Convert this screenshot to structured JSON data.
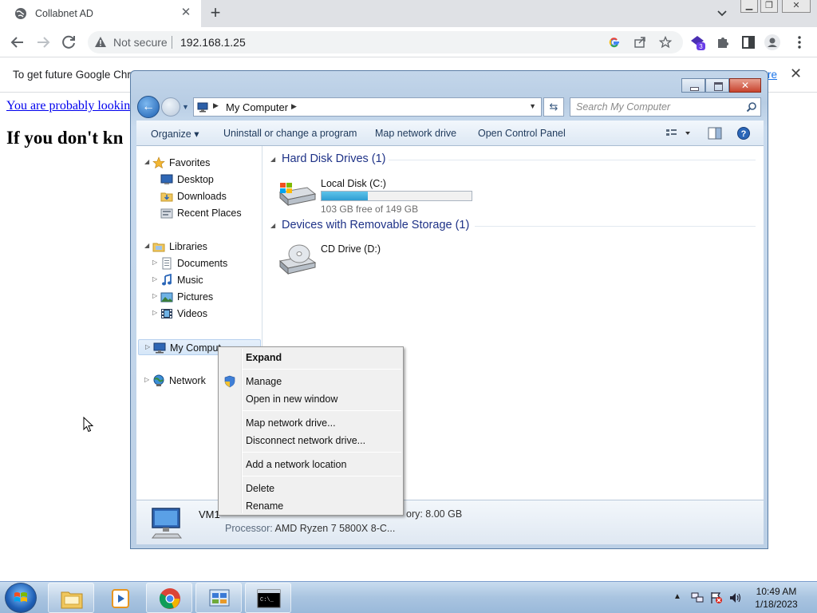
{
  "browser": {
    "tab_title": "Collabnet AD",
    "new_tab": "+",
    "security_label": "Not secure",
    "url": "192.168.1.25",
    "extension_badge": "3",
    "infobar_message": "To get future Google Chro",
    "infobar_link": "re"
  },
  "page": {
    "link_text": "You are probably lookin",
    "heading_text": "If you don't kn"
  },
  "explorer": {
    "breadcrumb": "My Computer",
    "search_placeholder": "Search My Computer",
    "commands": {
      "organize": "Organize",
      "uninstall": "Uninstall or change a program",
      "map_drive": "Map network drive",
      "control_panel": "Open Control Panel"
    },
    "nav": {
      "favorites": "Favorites",
      "desktop": "Desktop",
      "downloads": "Downloads",
      "recent": "Recent Places",
      "libraries": "Libraries",
      "documents": "Documents",
      "music": "Music",
      "pictures": "Pictures",
      "videos": "Videos",
      "my_computer": "My Comput",
      "network": "Network"
    },
    "groups": {
      "hdd": "Hard Disk Drives (1)",
      "removable": "Devices with Removable Storage (1)"
    },
    "drives": {
      "c_name": "Local Disk (C:)",
      "c_free": "103 GB free of 149 GB",
      "c_used_fraction": 0.31,
      "d_name": "CD Drive (D:)"
    },
    "details": {
      "name": "VM1",
      "memory": "ory: 8.00 GB",
      "processor_key": "Processor:",
      "processor_value": "AMD Ryzen 7 5800X 8-C..."
    }
  },
  "context_menu": {
    "expand": "Expand",
    "manage": "Manage",
    "open_new_window": "Open in new window",
    "map_drive": "Map network drive...",
    "disconnect_drive": "Disconnect network drive...",
    "add_location": "Add a network location",
    "delete": "Delete",
    "rename": "Rename"
  },
  "taskbar": {
    "time": "10:49 AM",
    "date": "1/18/2023"
  },
  "colors": {
    "accent": "#1a73e8",
    "explorer_frame": "#c3d6ea",
    "group_title": "#1e3287",
    "progress_fill": "#2f9ed2"
  },
  "icons": [
    "globe-icon",
    "close-icon",
    "chevron-down-icon",
    "back-arrow-icon",
    "forward-arrow-icon",
    "reload-icon",
    "warning-icon",
    "google-icon",
    "share-icon",
    "star-icon",
    "extension-icon",
    "puzzle-icon",
    "sidepanel-icon",
    "profile-icon",
    "more-icon",
    "computer-icon",
    "search-icon",
    "folder-icon",
    "shield-icon",
    "windows-flag-icon",
    "chrome-icon",
    "terminal-icon"
  ]
}
